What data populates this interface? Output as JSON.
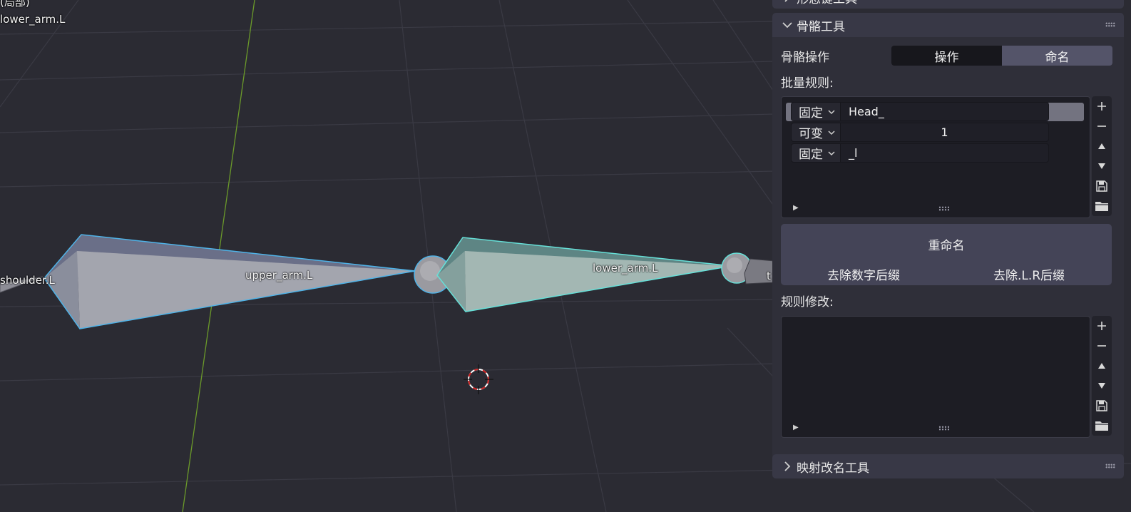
{
  "viewport": {
    "header_lines": [
      "(局部)",
      "lower_arm.L"
    ],
    "bone_labels": {
      "shoulder": "shoulder.L",
      "upper_arm": "upper_arm.L",
      "lower_arm": "lower_arm.L",
      "partial": "t"
    }
  },
  "panel": {
    "top_partial_header": "形态键工具",
    "section_title": "骨骼工具",
    "bone_op_label": "骨骼操作",
    "mode_tabs": [
      {
        "label": "操作",
        "active": false
      },
      {
        "label": "命名",
        "active": true
      }
    ],
    "batch_rules_label": "批量规则:",
    "rules": [
      {
        "type": "固定",
        "value": "Head_"
      },
      {
        "type": "可变",
        "value": "1"
      },
      {
        "type": "固定",
        "value": "_l"
      }
    ],
    "rename_button": "重命名",
    "remove_num_suffix": "去除数字后缀",
    "remove_lr_suffix": "去除.L.R后缀",
    "rule_edit_label": "规则修改:",
    "side_buttons": [
      "add-icon",
      "remove-icon",
      "move-up-icon",
      "move-down-icon",
      "save-icon",
      "folder-icon"
    ],
    "mapping_section_title": "映射改名工具"
  },
  "colors": {
    "viewport_bg": "#2b2b33",
    "selection_outline": "#4fb3e8",
    "active_outline": "#66e0d8",
    "active_tab": "#545469"
  }
}
